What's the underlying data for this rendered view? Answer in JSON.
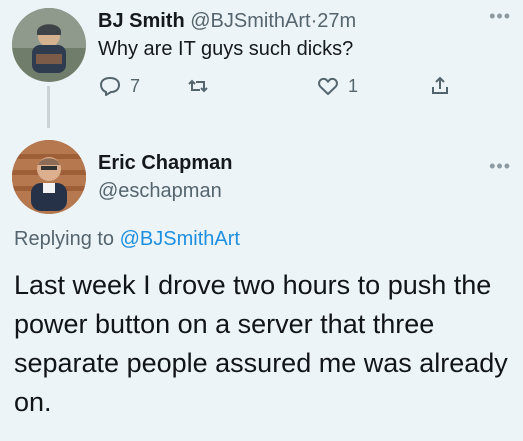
{
  "parent_tweet": {
    "display_name": "BJ Smith",
    "handle": "@BJSmithArt",
    "separator": "·",
    "timestamp": "27m",
    "text": "Why are IT guys such dicks?",
    "actions": {
      "reply_count": "7",
      "retweet_count": "",
      "like_count": "1"
    },
    "icons": [
      "more-icon",
      "reply-icon",
      "retweet-icon",
      "heart-icon",
      "share-icon"
    ]
  },
  "reply_tweet": {
    "display_name": "Eric Chapman",
    "handle": "@eschapman",
    "replying_prefix": "Replying to",
    "replying_handle": "@BJSmithArt",
    "text": "Last week I drove two hours to push the power button on a server that three separate people assured me was already on.",
    "icons": [
      "more-icon"
    ]
  },
  "colors": {
    "background": "#edf4f7",
    "link": "#1d8fe0",
    "muted": "#55656e"
  }
}
